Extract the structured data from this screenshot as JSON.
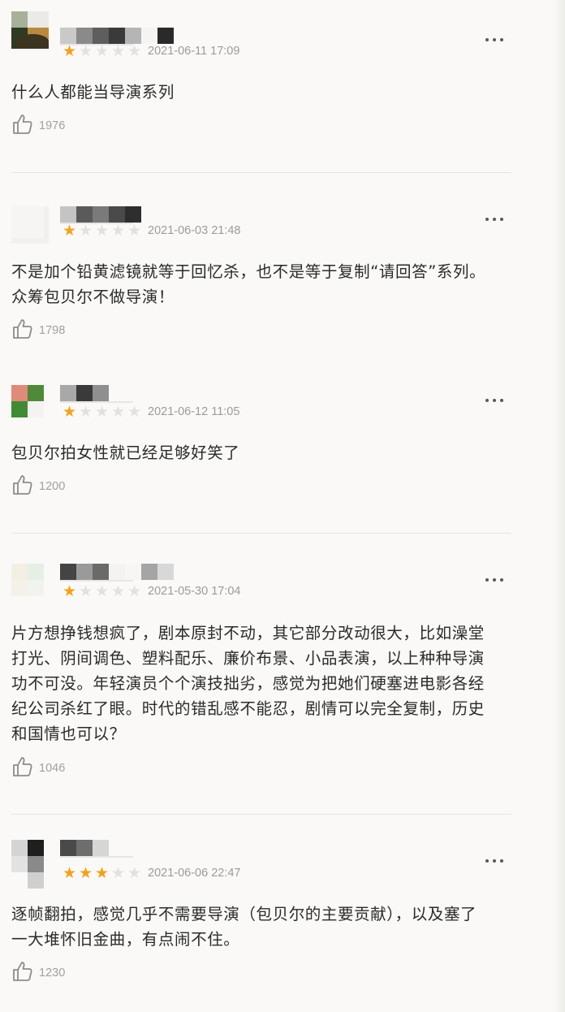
{
  "comments": [
    {
      "date": "2021-06-11 17:09",
      "rating": 1,
      "text_lines": [
        "什么人都能当导演系列"
      ],
      "likes": "1976",
      "avatar_icon": "user-avatar-icon"
    },
    {
      "date": "2021-06-03 21:48",
      "rating": 1,
      "text_lines": [
        "不是加个铅黄滤镜就等于回忆杀，也不是等于复制“请回答”系列。",
        "众筹包贝尔不做导演！"
      ],
      "likes": "1798",
      "avatar_icon": "user-avatar-icon"
    },
    {
      "date": "2021-06-12 11:05",
      "rating": 1,
      "text_lines": [
        "包贝尔拍女性就已经足够好笑了"
      ],
      "likes": "1200",
      "avatar_icon": "user-avatar-icon"
    },
    {
      "date": "2021-05-30 17:04",
      "rating": 1,
      "text_lines": [
        "片方想挣钱想疯了，剧本原封不动，其它部分改动很大，比如澡堂",
        "打光、阴间调色、塑料配乐、廉价布景、小品表演，以上种种导演",
        "功不可没。年轻演员个个演技拙劣，感觉为把她们硬塞进电影各经",
        "纪公司杀红了眼。时代的错乱感不能忍，剧情可以完全复制，历史",
        "和国情也可以？"
      ],
      "likes": "1046",
      "avatar_icon": "user-avatar-icon"
    },
    {
      "date": "2021-06-06 22:47",
      "rating": 3,
      "text_lines": [
        "逐帧翻拍，感觉几乎不需要导演（包贝尔的主要贡献），以及塞了",
        "一大堆怀旧金曲，有点闹不住。"
      ],
      "likes": "1230",
      "avatar_icon": "user-avatar-icon"
    }
  ],
  "icons": {
    "like": "thumbs-up-icon",
    "more": "more-options-icon",
    "star": "star-icon"
  },
  "colors": {
    "star_on": "#f5a11c",
    "star_off": "#e3e1de",
    "meta_text": "#9e9b97",
    "background": "#faf9f7"
  }
}
